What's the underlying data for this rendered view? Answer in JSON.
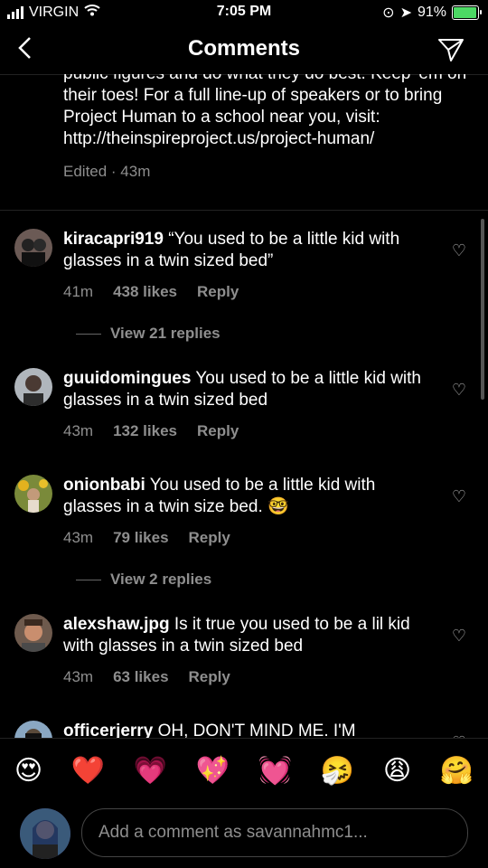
{
  "status": {
    "carrier": "VIRGIN",
    "time": "7:05 PM",
    "battery": "91%",
    "battery_level": 0.91
  },
  "nav": {
    "title": "Comments"
  },
  "caption": {
    "text": "public figures and do what they do best. Keep 'em on their toes! For a full line-up of speakers or to bring Project Human to a school near you, visit: http://theinspireproject.us/project-human/",
    "meta": "Edited · 43m"
  },
  "comments": [
    {
      "user": "kiracapri919",
      "text": "“You used to be a little kid with glasses in a twin sized bed”",
      "time": "41m",
      "likes": "438 likes",
      "reply": "Reply",
      "view_replies": "View 21 replies"
    },
    {
      "user": "guuidomingues",
      "text": "You used to be a little kid with glasses in a twin sized bed",
      "time": "43m",
      "likes": "132 likes",
      "reply": "Reply"
    },
    {
      "user": "onionbabi",
      "text": "You used to be a little kid with glasses in a twin size bed. 🤓",
      "time": "43m",
      "likes": "79 likes",
      "reply": "Reply",
      "view_replies": "View 2 replies"
    },
    {
      "user": "alexshaw.jpg",
      "text": "Is it true you used to be a lil kid with glasses in a twin sized bed",
      "time": "43m",
      "likes": "63 likes",
      "reply": "Reply"
    },
    {
      "user": "officerjerry",
      "text": "OH, DON'T MIND ME. I'M"
    }
  ],
  "emojis": [
    "😍",
    "❤️",
    "💗",
    "💖",
    "💓",
    "🤧",
    "😩",
    "🤗"
  ],
  "composer": {
    "placeholder": "Add a comment as savannahmc1..."
  }
}
